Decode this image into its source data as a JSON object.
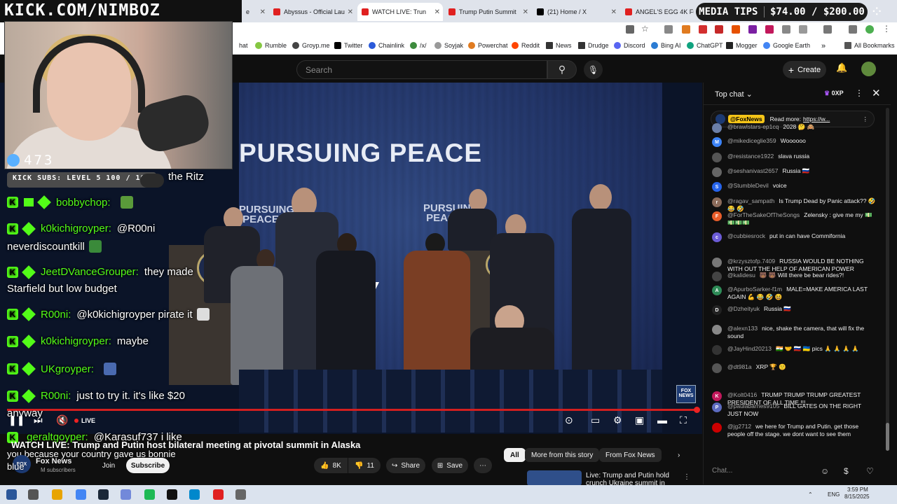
{
  "brand_overlay": "KICK.COM/NIMBOZ",
  "media_tips": {
    "label": "MEDIA TIPS",
    "amount": "$74.00 / $200.00"
  },
  "webcam": {
    "viewer_count": "473"
  },
  "kick_subs": "KICK SUBS: LEVEL 5 100 / 100",
  "tabs": [
    {
      "label": "e",
      "color": "#7c3aed"
    },
    {
      "label": "Abyssus - Official Lau",
      "color": "#e02020"
    },
    {
      "label": "WATCH LIVE: Trun",
      "color": "#e02020"
    },
    {
      "label": "Trump Putin Summit",
      "color": "#e02020"
    },
    {
      "label": "(21) Home / X",
      "color": "#000000"
    },
    {
      "label": "ANGEL'S EGG 4K Ful",
      "color": "#e02020"
    }
  ],
  "bookmarks": [
    {
      "label": "hat",
      "color": "#888888"
    },
    {
      "label": "Rumble",
      "color": "#85c742"
    },
    {
      "label": "Groyp.me",
      "color": "#444444"
    },
    {
      "label": "Twitter",
      "color": "#000000"
    },
    {
      "label": "Chainlink",
      "color": "#2a5ada"
    },
    {
      "label": "/x/",
      "color": "#3d8b3d"
    },
    {
      "label": "Soyjak",
      "color": "#999999"
    },
    {
      "label": "Powerchat",
      "color": "#e07b20"
    },
    {
      "label": "Reddit",
      "color": "#ff4500"
    },
    {
      "label": "News",
      "color": "#333333"
    },
    {
      "label": "Drudge",
      "color": "#333333"
    },
    {
      "label": "Discord",
      "color": "#5865f2"
    },
    {
      "label": "Bing AI",
      "color": "#2b7cd3"
    },
    {
      "label": "ChatGPT",
      "color": "#10a37f"
    },
    {
      "label": "Mogger",
      "color": "#222222"
    },
    {
      "label": "Google Earth",
      "color": "#4285f4"
    },
    {
      "label": "All Bookmarks",
      "color": "#555555"
    }
  ],
  "search": {
    "placeholder": "Search"
  },
  "header": {
    "create": "Create"
  },
  "video": {
    "backdrop_text": "PURSUING PEACE",
    "podium_sign": "PURSUING PEACE",
    "podium_sign_2": "PURSUING PEACE",
    "bug": "FOX NEWS",
    "live": "LIVE"
  },
  "kick_chat": [
    {
      "user": "",
      "text": "the Ritz"
    },
    {
      "user": "bobbychop:",
      "text": ""
    },
    {
      "user": "k0kichigroyper:",
      "text": "@R00ni"
    },
    {
      "user": "",
      "text": "neverdiscountkill"
    },
    {
      "user": "JeetDVanceGrouper:",
      "text": "they made"
    },
    {
      "user": "",
      "text": "Starfield but low budget"
    },
    {
      "user": "R00ni:",
      "text": "@k0kichigroyper pirate it"
    },
    {
      "user": "k0kichigroyper:",
      "text": "maybe"
    },
    {
      "user": "UKgroyper:",
      "text": ""
    },
    {
      "user": "R00ni:",
      "text": "just to try it. it's like $20"
    },
    {
      "user": "",
      "text": "anyway"
    },
    {
      "user": "geraltgoyper:",
      "text": "@Karasuf737 i like"
    },
    {
      "user": "",
      "text": "you because your country gave us bonnie"
    },
    {
      "user": "",
      "text": "blue"
    }
  ],
  "video_info": {
    "title": "WATCH LIVE: Trump and Putin host bilateral meeting at pivotal summit in Alaska",
    "channel": "Fox News",
    "subs": "M subscribers",
    "join": "Join",
    "subscribe": "Subscribe",
    "likes": "8K",
    "dislikes": "11",
    "share": "Share",
    "save": "Save"
  },
  "chips": [
    "All",
    "More from this story",
    "From Fox News"
  ],
  "recommended": {
    "title": "Live: Trump and Putin hold crunch Ukraine summit in"
  },
  "live_chat": {
    "title": "Top chat",
    "xp": "0XP",
    "pinned_channel": "@FoxNews",
    "pinned_text": "Read more:",
    "pinned_link": "https://w...",
    "input_placeholder": "Chat...",
    "messages": [
      {
        "author": "@brawlstars-ep1cq",
        "text": "2028 🤔 🙈",
        "color": "#6b7fa8",
        "initial": ""
      },
      {
        "author": "@mikediceglie359",
        "text": "Woooooo",
        "color": "#3b82f6",
        "initial": "M"
      },
      {
        "author": "@resistance1922",
        "text": "slava russia",
        "color": "#555555",
        "initial": ""
      },
      {
        "author": "@seshanivast2657",
        "text": "Russia 🇷🇺",
        "color": "#666666",
        "initial": ""
      },
      {
        "author": "@StumbleDevil",
        "text": "voice",
        "color": "#2563eb",
        "initial": "S"
      },
      {
        "author": "@ragav_sampath",
        "text": "Is Trump Dead by Panic attack?? 🤣 😂 🤣",
        "color": "#8b6b5a",
        "initial": "r"
      },
      {
        "author": "@ForTheSakeOfTheSongs",
        "text": "Zelensky : give me my 💵💵💵💵",
        "color": "#e85d2a",
        "initial": "F"
      },
      {
        "author": "@cubbiesrock",
        "text": "put in can have Commifornia",
        "color": "#6b5bd6",
        "initial": "c"
      },
      {
        "author": "@krzysztofp.7409",
        "text": "RUSSIA WOULD BE NOTHING WITH OUT THE HELP OF AMERICAN POWER",
        "color": "#777777",
        "initial": ""
      },
      {
        "author": "@kalidesu",
        "text": "🐻 🐻 Will there be bear rides?!",
        "color": "#444444",
        "initial": ""
      },
      {
        "author": "@ApurboSarker-f1m",
        "text": "MALE=MAKE AMERICA LAST AGAIN 💪 😂 🤣 😆",
        "color": "#2e8b57",
        "initial": "A"
      },
      {
        "author": "@Dzheityuk",
        "text": "Russia 🇷🇺",
        "color": "#222222",
        "initial": "D"
      },
      {
        "author": "@alexn133",
        "text": "nice, shake the camera, that will fix the sound",
        "color": "#888888",
        "initial": ""
      },
      {
        "author": "@JayHind20213",
        "text": "🇮🇳 🤝 🇷🇺 🇺🇦 pics 🙏 🙏 🙏 🙏",
        "color": "#333333",
        "initial": ""
      },
      {
        "author": "@dt981a",
        "text": "XRP 🏆 🙂",
        "color": "#555555",
        "initial": ""
      },
      {
        "author": "@Kolt0416",
        "text": "TRUMP TRUMP TRUMP GREATEST PRESIDENT OF ALL TIME !!!",
        "color": "#c2185b",
        "initial": "K"
      },
      {
        "author": "@paulabarnes9105",
        "text": "BILL GATES ON THE RIGHT JUST NOW",
        "color": "#5c6bc0",
        "initial": "P"
      },
      {
        "author": "@jg2712",
        "text": "we here for Trump and Putin. get those people off the stage. we dont want to see them",
        "color": "#cc0000",
        "initial": ""
      }
    ]
  },
  "taskbar": {
    "lang": "ENG",
    "time": "3:59 PM",
    "date": "8/15/2025",
    "apps": [
      "#2b579a",
      "#555555",
      "#e8a400",
      "#4285f4",
      "#1b2838",
      "#7289da",
      "#1db954",
      "#111111",
      "#0088cc",
      "#e02020",
      "#666666"
    ]
  }
}
